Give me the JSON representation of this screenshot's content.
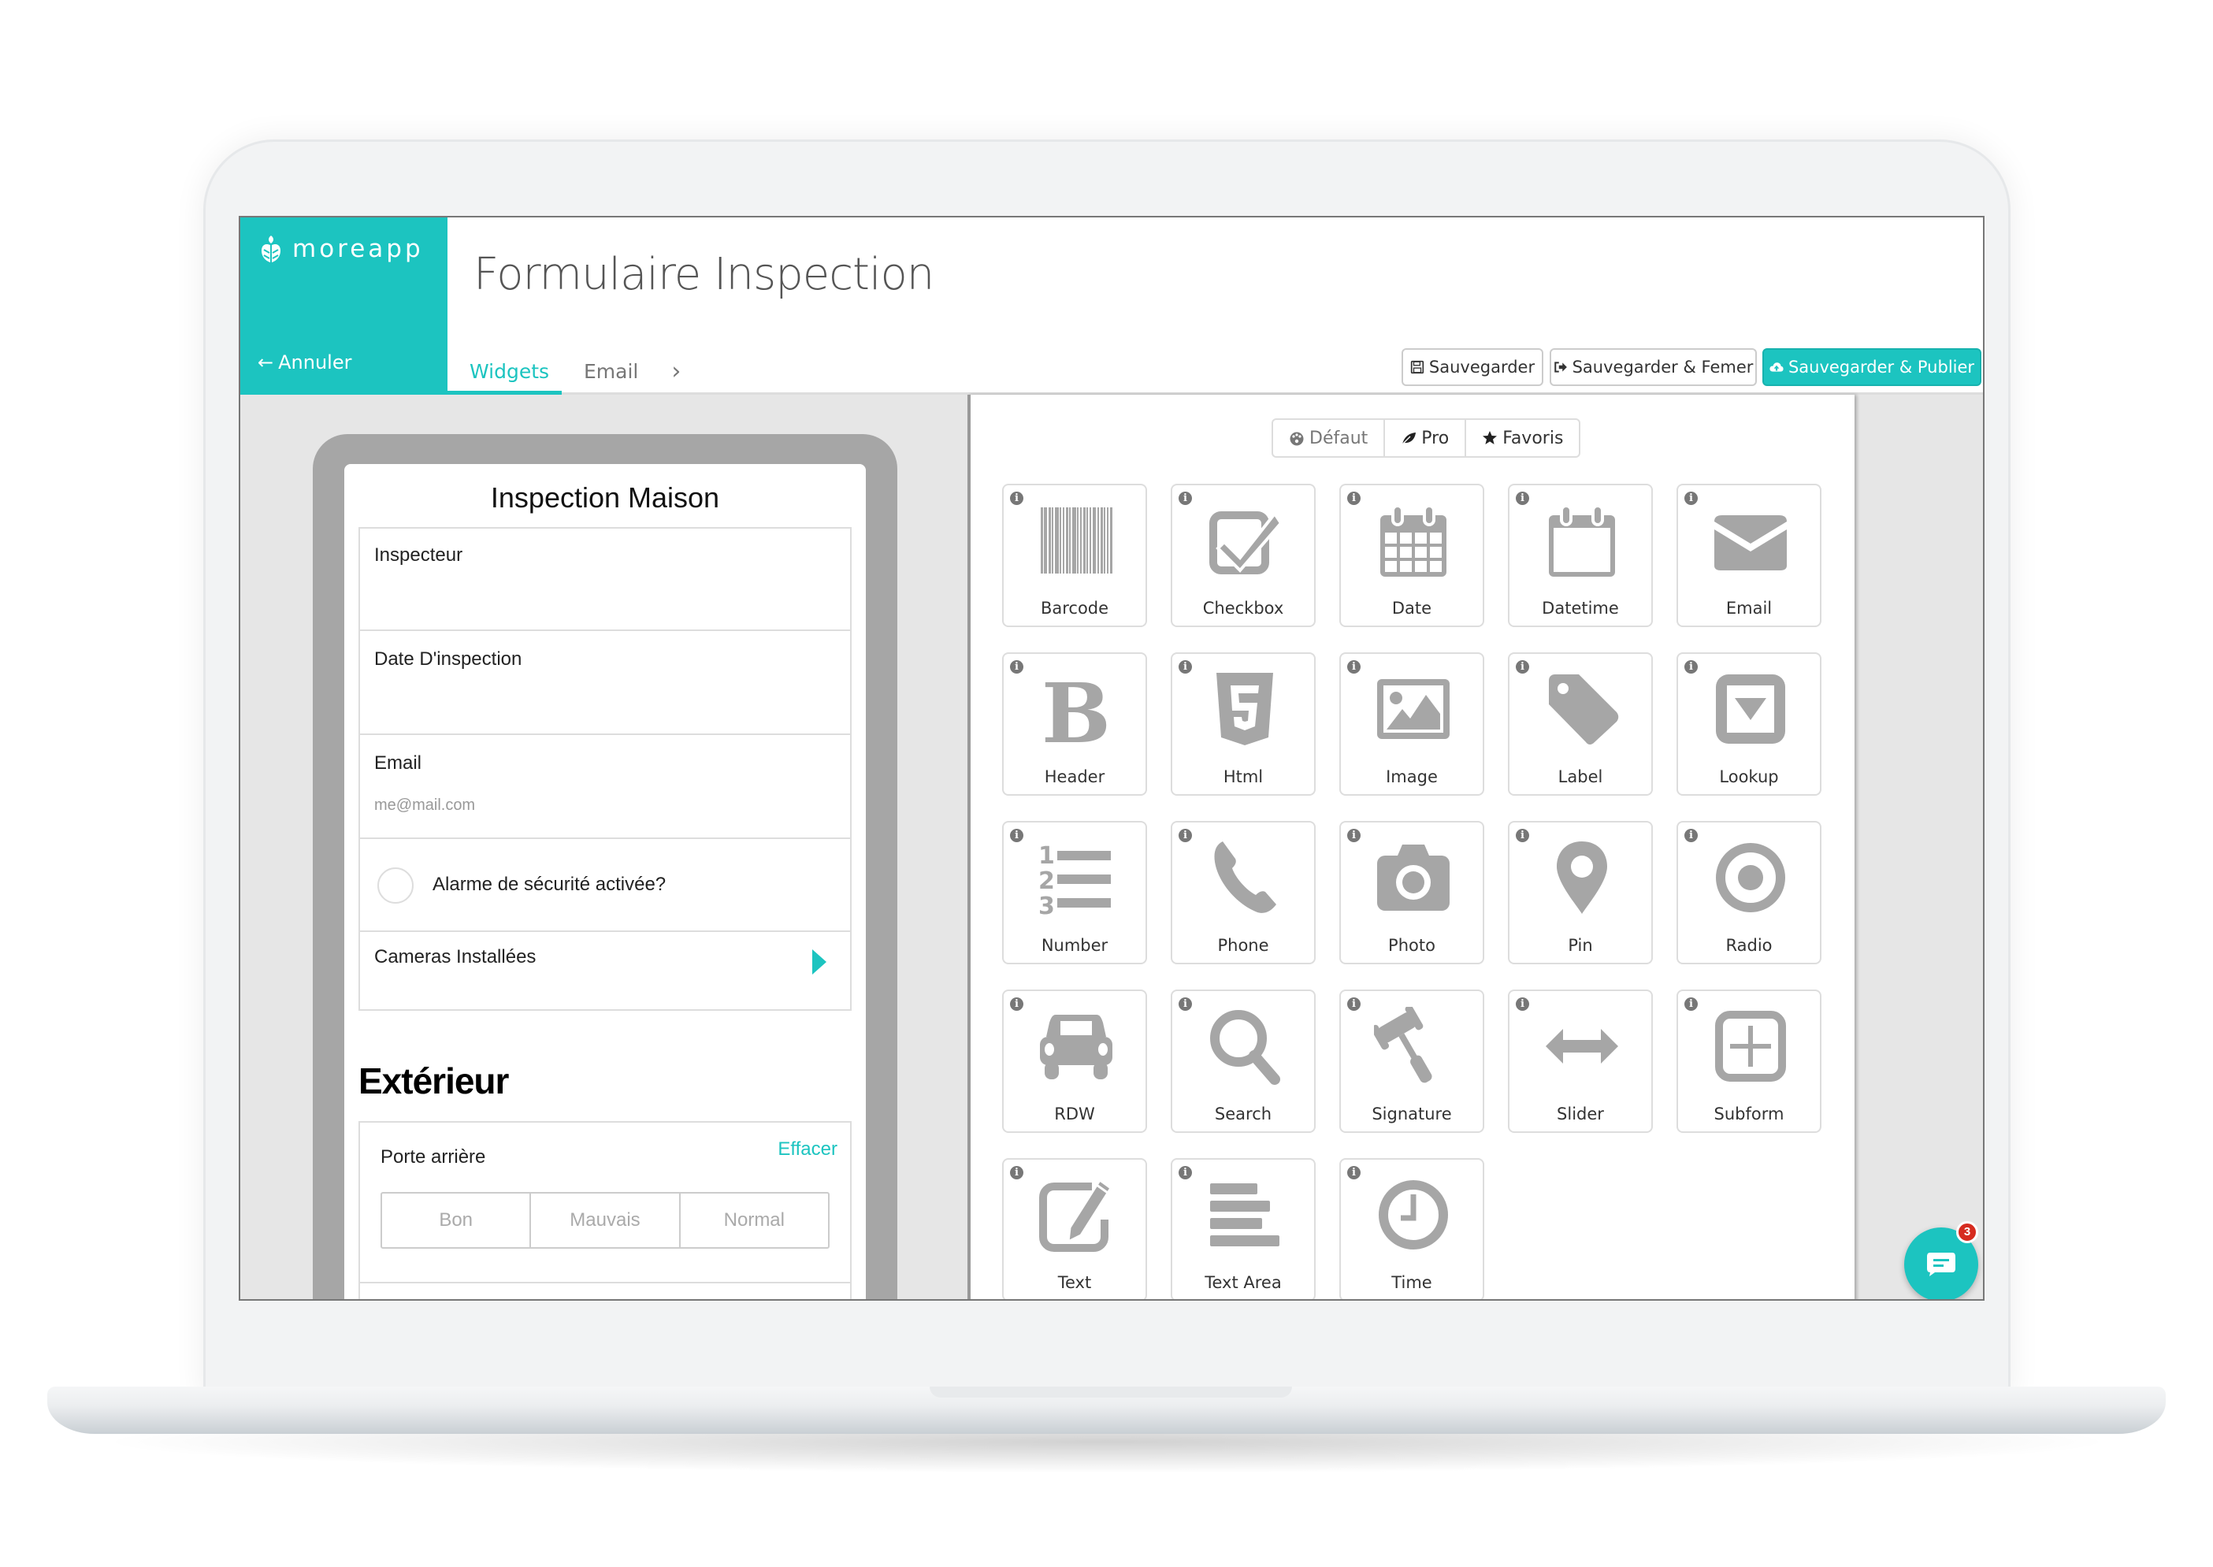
{
  "app": {
    "brand": "moreapp",
    "cancel_label": "Annuler",
    "title": "Formulaire Inspection",
    "accent_color": "#1cc4c0"
  },
  "tabs": [
    {
      "label": "Widgets",
      "active": true
    },
    {
      "label": "Email",
      "active": false
    }
  ],
  "toolbar": {
    "save_label": "Sauvegarder",
    "save_close_label": "Sauvegarder & Femer",
    "save_publish_label": "Sauvegarder & Publier"
  },
  "preview": {
    "form_title": "Inspection Maison",
    "fields": [
      {
        "label": "Inspecteur"
      },
      {
        "label": "Date D'inspection"
      },
      {
        "label": "Email",
        "placeholder": "me@mail.com"
      },
      {
        "label": "Alarme de sécurité activée?",
        "type": "checkbox",
        "checked": false
      },
      {
        "label": "Cameras Installées",
        "type": "subform"
      }
    ],
    "section_title": "Extérieur",
    "radio_field": {
      "label": "Porte arrière",
      "clear_label": "Effacer",
      "options": [
        "Bon",
        "Mauvais",
        "Normal"
      ]
    }
  },
  "widget_categories": [
    {
      "label": "Défaut",
      "icon": "dashboard-icon",
      "active": true
    },
    {
      "label": "Pro",
      "icon": "leaf-icon",
      "active": false
    },
    {
      "label": "Favoris",
      "icon": "star-icon",
      "active": false
    }
  ],
  "widgets": [
    {
      "label": "Barcode",
      "icon": "barcode-icon"
    },
    {
      "label": "Checkbox",
      "icon": "checkbox-icon"
    },
    {
      "label": "Date",
      "icon": "calendar-icon"
    },
    {
      "label": "Datetime",
      "icon": "calendar-empty-icon"
    },
    {
      "label": "Email",
      "icon": "envelope-icon"
    },
    {
      "label": "Header",
      "icon": "bold-icon"
    },
    {
      "label": "Html",
      "icon": "html5-icon"
    },
    {
      "label": "Image",
      "icon": "image-icon"
    },
    {
      "label": "Label",
      "icon": "tag-icon"
    },
    {
      "label": "Lookup",
      "icon": "dropdown-icon"
    },
    {
      "label": "Number",
      "icon": "ordered-list-icon"
    },
    {
      "label": "Phone",
      "icon": "phone-icon"
    },
    {
      "label": "Photo",
      "icon": "camera-icon"
    },
    {
      "label": "Pin",
      "icon": "map-pin-icon"
    },
    {
      "label": "Radio",
      "icon": "radio-icon"
    },
    {
      "label": "RDW",
      "icon": "car-icon"
    },
    {
      "label": "Search",
      "icon": "search-icon"
    },
    {
      "label": "Signature",
      "icon": "gavel-icon"
    },
    {
      "label": "Slider",
      "icon": "arrows-horizontal-icon"
    },
    {
      "label": "Subform",
      "icon": "plus-square-icon"
    },
    {
      "label": "Text",
      "icon": "edit-icon"
    },
    {
      "label": "Text Area",
      "icon": "align-left-icon"
    },
    {
      "label": "Time",
      "icon": "clock-icon"
    }
  ],
  "chat": {
    "badge_count": "3"
  }
}
